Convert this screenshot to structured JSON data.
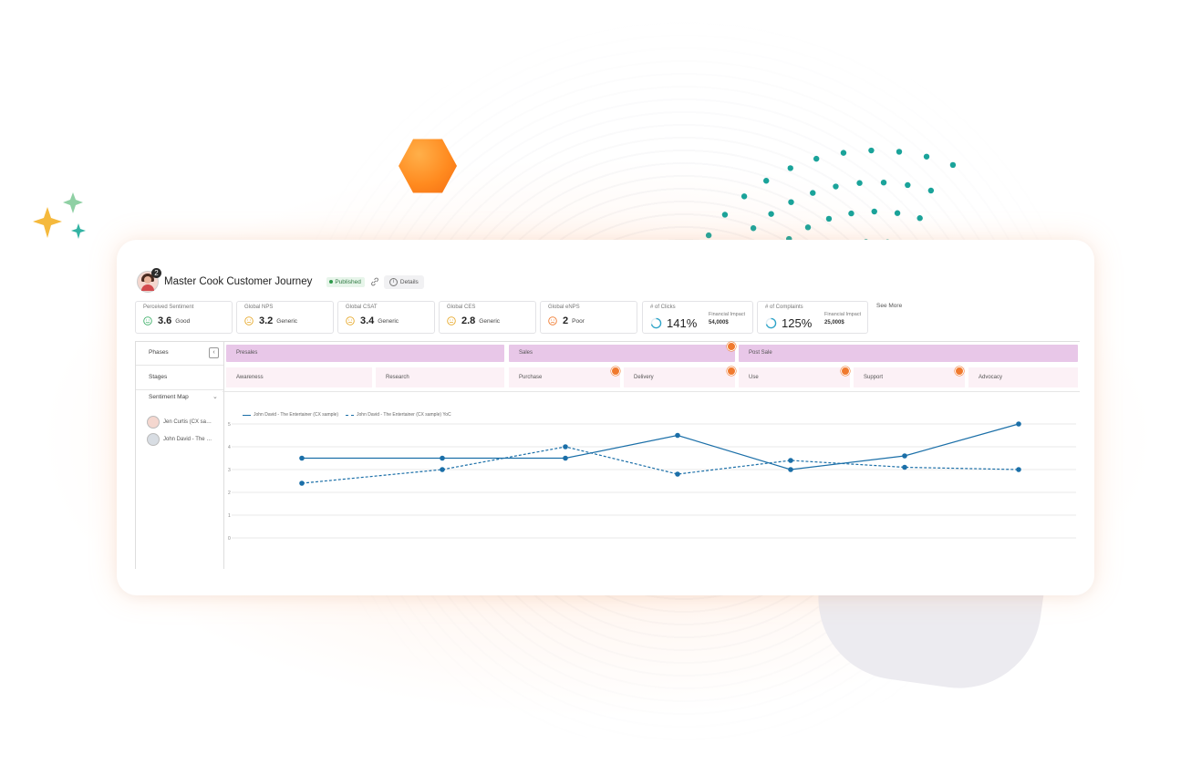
{
  "header": {
    "title": "Master Cook Customer Journey",
    "avatar_count": "2",
    "status": "Published",
    "details_label": "Details"
  },
  "metrics": [
    {
      "label": "Perceived Sentiment",
      "value": "3.6",
      "text": "Good",
      "icon": "smiley-green-icon"
    },
    {
      "label": "Global NPS",
      "value": "3.2",
      "text": "Generic",
      "icon": "smiley-yellow-icon"
    },
    {
      "label": "Global CSAT",
      "value": "3.4",
      "text": "Generic",
      "icon": "smiley-yellow-icon"
    },
    {
      "label": "Global CES",
      "value": "2.8",
      "text": "Generic",
      "icon": "smiley-yellow-icon"
    },
    {
      "label": "Global eNPS",
      "value": "2",
      "text": "Poor",
      "icon": "smiley-orange-icon"
    }
  ],
  "kpis": [
    {
      "label": "# of Clicks",
      "value": "141%",
      "fin_label": "Financial Impact",
      "fin_value": "54,000$"
    },
    {
      "label": "# of Complaints",
      "value": "125%",
      "fin_label": "Financial Impact",
      "fin_value": "25,000$"
    }
  ],
  "see_more": "See More",
  "left_column": {
    "phases_label": "Phases",
    "stages_label": "Stages",
    "sentiment_map_label": "Sentiment Map",
    "personas": [
      "Jen Curtis (CX sa…",
      "John David - The …"
    ]
  },
  "phases": [
    "Presales",
    "Sales",
    "Post Sale"
  ],
  "stages": [
    "Awareness",
    "Research",
    "Purchase",
    "Delivery",
    "Use",
    "Support",
    "Advocacy"
  ],
  "colors": {
    "phase_bg": "#e8c7e8",
    "stage_bg": "#fcf1f6",
    "series": "#1b6fa8",
    "flag": "#f07a2e",
    "dots": "#1aa39a",
    "hexagon": "#ff8a1f"
  },
  "chart_data": {
    "type": "line",
    "categories": [
      "Awareness",
      "Research",
      "Purchase",
      "Delivery",
      "Use",
      "Support",
      "Advocacy"
    ],
    "series": [
      {
        "name": "John David - The Entertainer (CX sample)",
        "style": "solid",
        "values": [
          3.5,
          3.5,
          3.5,
          4.5,
          3.0,
          3.6,
          5.0
        ]
      },
      {
        "name": "John David - The Entertainer (CX sample) YoC",
        "style": "dashed",
        "values": [
          2.4,
          3.0,
          4.0,
          2.8,
          3.4,
          3.1,
          3.0
        ]
      }
    ],
    "yticks": [
      "0",
      "1",
      "2",
      "3",
      "4",
      "5"
    ],
    "ylim": [
      0,
      5
    ],
    "grid": true
  }
}
